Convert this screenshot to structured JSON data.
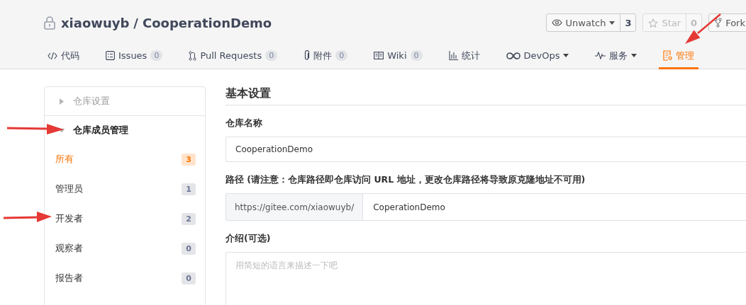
{
  "repo": {
    "owner": "xiaowuyb",
    "separator": "/",
    "name": "CooperationDemo",
    "private": true
  },
  "actions": [
    {
      "kind": "eye",
      "label": "Unwatch",
      "dropdown": true,
      "disabled": false,
      "count": "3"
    },
    {
      "kind": "star",
      "label": "Star",
      "dropdown": false,
      "disabled": true,
      "count": "0"
    },
    {
      "kind": "fork",
      "label": "Fork",
      "dropdown": false,
      "disabled": false
    }
  ],
  "tabs": [
    {
      "kind": "code",
      "label": "代码",
      "selected": false
    },
    {
      "kind": "issues",
      "label": "Issues",
      "count": "0",
      "selected": false
    },
    {
      "kind": "pr",
      "label": "Pull Requests",
      "count": "0",
      "selected": false
    },
    {
      "kind": "clip",
      "label": "附件",
      "count": "0",
      "selected": false
    },
    {
      "kind": "book",
      "label": "Wiki",
      "count": "0",
      "selected": false
    },
    {
      "kind": "chart",
      "label": "统计",
      "selected": false
    },
    {
      "kind": "infinity",
      "label": "DevOps",
      "dropdown": true,
      "selected": false
    },
    {
      "kind": "pulse",
      "label": "服务",
      "dropdown": true,
      "selected": false
    },
    {
      "kind": "doc",
      "label": "管理",
      "selected": true
    }
  ],
  "sidebar": {
    "sections": [
      {
        "title": "仓库设置",
        "expanded": false
      },
      {
        "title": "仓库成员管理",
        "expanded": true,
        "items": [
          {
            "label": "所有",
            "count": "3",
            "selected": true
          },
          {
            "label": "管理员",
            "count": "1",
            "selected": false
          },
          {
            "label": "开发者",
            "count": "2",
            "selected": false
          },
          {
            "label": "观察者",
            "count": "0",
            "selected": false
          },
          {
            "label": "报告者",
            "count": "0",
            "selected": false
          }
        ]
      }
    ]
  },
  "form": {
    "heading": "基本设置",
    "fields": [
      {
        "kind": "text",
        "label": "仓库名称",
        "value": "CooperationDemo"
      },
      {
        "kind": "prefixed",
        "label": "路径 (请注意：仓库路径即仓库访问 URL 地址，更改仓库路径将导致原克隆地址不可用)",
        "prefix": "https://gitee.com/xiaowuyb/",
        "value": "CoperationDemo"
      },
      {
        "kind": "textarea",
        "label": "介绍(可选)",
        "placeholder": "用简短的语言来描述一下吧"
      }
    ]
  }
}
